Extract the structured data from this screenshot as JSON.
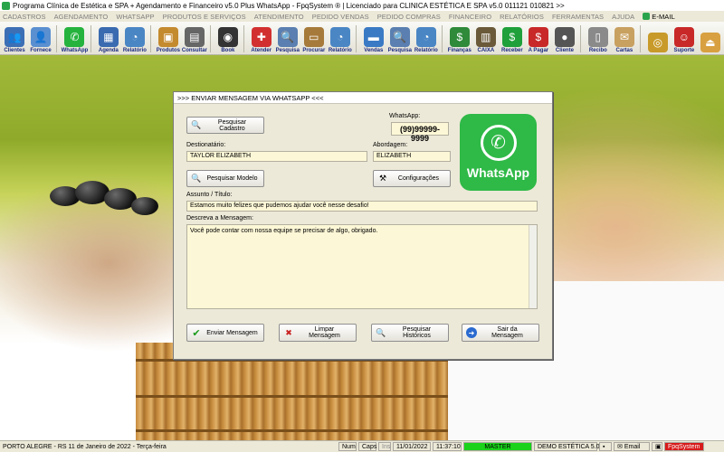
{
  "window": {
    "title": "Programa Clínica de Estética e SPA + Agendamento e Financeiro v5.0 Plus WhatsApp - FpqSystem ® | Licenciado para  CLINICA ESTÉTICA E SPA v5.0 011121 010821 >>"
  },
  "menu": [
    "CADASTROS",
    "AGENDAMENTO",
    "WHATSAPP",
    "PRODUTOS E SERVIÇOS",
    "ATENDIMENTO",
    "PEDIDO VENDAS",
    "PEDIDO COMPRAS",
    "FINANCEIRO",
    "RELATÓRIOS",
    "FERRAMENTAS",
    "AJUDA"
  ],
  "menu_email": "E-MAIL",
  "toolbar": [
    {
      "label": "Clientes",
      "icon": "clients-icon",
      "color": "#3d6fb5"
    },
    {
      "label": "Fornece",
      "icon": "suppliers-icon",
      "color": "#5a8fd0"
    },
    {
      "label": "WhatsApp",
      "icon": "whatsapp-icon",
      "color": "#25b33e"
    },
    {
      "label": "Agenda",
      "icon": "agenda-icon",
      "color": "#3a6ab0"
    },
    {
      "label": "Relatório",
      "icon": "report-icon",
      "color": "#4a86c4"
    },
    {
      "label": "Produtos",
      "icon": "products-icon",
      "color": "#c48a2e"
    },
    {
      "label": "Consultar",
      "icon": "consult-icon",
      "color": "#666666"
    },
    {
      "label": "Book",
      "icon": "camera-icon",
      "color": "#333333"
    },
    {
      "label": "Atender",
      "icon": "attend-icon",
      "color": "#d23030"
    },
    {
      "label": "Pesquisa",
      "icon": "search-icon",
      "color": "#5a7fb0"
    },
    {
      "label": "Procurar",
      "icon": "find-icon",
      "color": "#a67a3a"
    },
    {
      "label": "Relatório",
      "icon": "report-icon",
      "color": "#4a86c4"
    },
    {
      "label": "Vendas",
      "icon": "sales-icon",
      "color": "#3a7ac4"
    },
    {
      "label": "Pesquisa",
      "icon": "search-icon",
      "color": "#5a7fb0"
    },
    {
      "label": "Relatório",
      "icon": "report-icon",
      "color": "#4a86c4"
    },
    {
      "label": "Finanças",
      "icon": "finance-icon",
      "color": "#2f8a3a"
    },
    {
      "label": "CAIXA",
      "icon": "cashier-icon",
      "color": "#6a5a3a"
    },
    {
      "label": "Receber",
      "icon": "receive-icon",
      "color": "#1fa03a"
    },
    {
      "label": "A Pagar",
      "icon": "pay-icon",
      "color": "#c82828"
    },
    {
      "label": "Cliente",
      "icon": "client-icon",
      "color": "#555555"
    },
    {
      "label": "Recibo",
      "icon": "receipt-icon",
      "color": "#8a8a8a"
    },
    {
      "label": "Cartas",
      "icon": "letters-icon",
      "color": "#c8a060"
    },
    {
      "label": "",
      "icon": "coin-icon",
      "color": "#c89a2a"
    },
    {
      "label": "Suporte",
      "icon": "support-icon",
      "color": "#c82828"
    },
    {
      "label": "",
      "icon": "exit-icon",
      "color": "#d8a040"
    }
  ],
  "dialog": {
    "title": ">>> ENVIAR MENSAGEM VIA WHATSAPP <<<",
    "btn_search_client": "Pesquisar Cadastro",
    "whatsapp_label": "WhatsApp:",
    "whatsapp_value": "(99)99999-9999",
    "recipient_label": "Destionatário:",
    "recipient_value": "TAYLOR ELIZABETH",
    "approach_label": "Abordagem:",
    "approach_value": "ELIZABETH",
    "btn_search_model": "Pesquisar Modelo",
    "btn_settings": "Configurações",
    "subject_label": "Assunto / Título:",
    "subject_value": "Estamos muito felizes que pudemos ajudar você nesse desafio!",
    "message_label": "Descreva a Mensagem:",
    "message_value": "Você pode contar com nossa equipe se precisar de algo, obrigado.",
    "logo_text": "WhatsApp",
    "btn_send": "Enviar Mensagem",
    "btn_clear": "Limpar Mensagem",
    "btn_history": "Pesquisar Históricos",
    "btn_exit": "Sair da Mensagem"
  },
  "status": {
    "location_date": "PORTO ALEGRE - RS 11 de Janeiro de 2022 - Terça-feira",
    "num": "Num",
    "caps": "Caps",
    "ins": "Ins",
    "date": "11/01/2022",
    "time": "11:37:10",
    "master": "MASTER",
    "demo": "DEMO ESTÉTICA 5.0",
    "email": "Email",
    "brand": "FpqSystem"
  }
}
